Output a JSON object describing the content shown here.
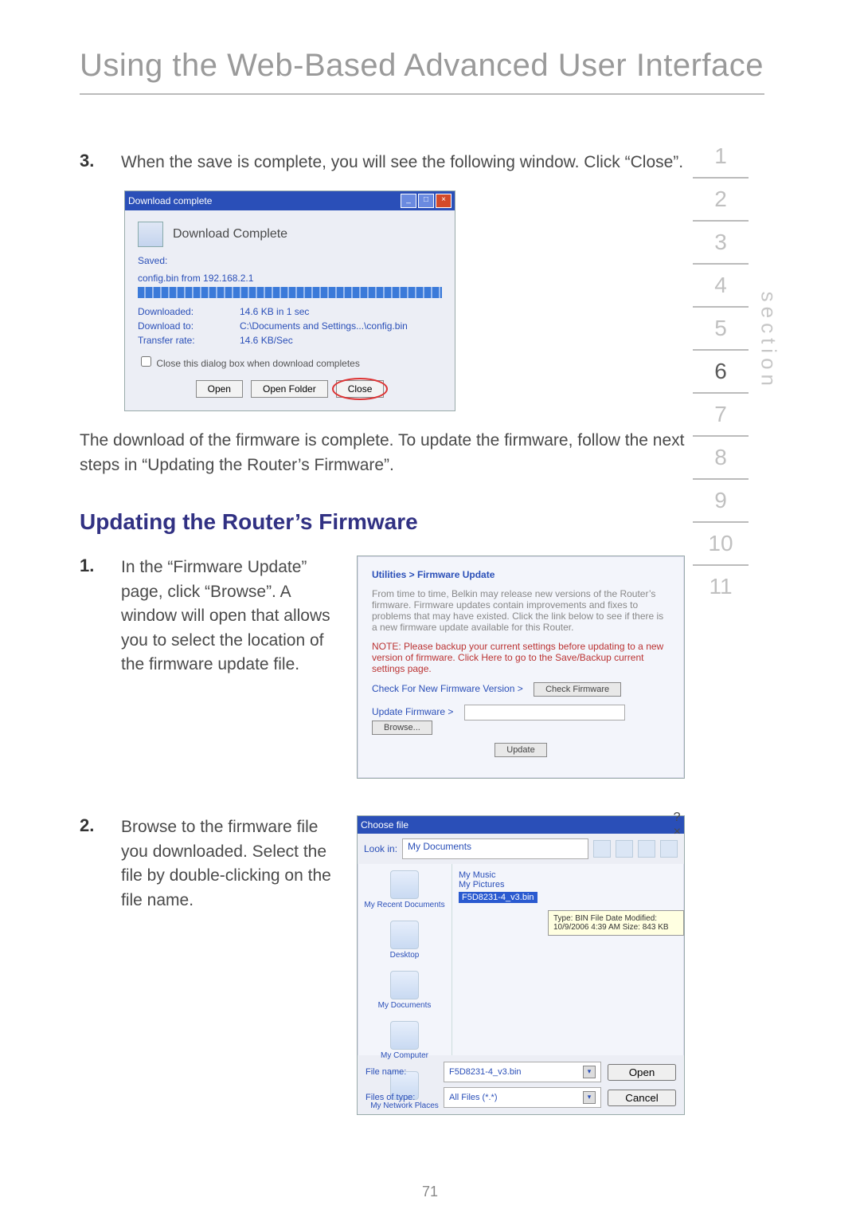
{
  "heading": "Using the Web-Based Advanced User Interface",
  "section_label": "section",
  "section_numbers": [
    "1",
    "2",
    "3",
    "4",
    "5",
    "6",
    "7",
    "8",
    "9",
    "10",
    "11"
  ],
  "active_section_index": 5,
  "page_number": "71",
  "step3": {
    "num": "3.",
    "body": "When the save is complete, you will see the following window. Click “Close”."
  },
  "para_after_ss1": "The download of the firmware is complete. To update the firmware, follow the next steps in “Updating the Router’s Firmware”.",
  "subheading": "Updating the Router’s Firmware",
  "step1": {
    "num": "1.",
    "body": "In the “Firmware Update” page, click “Browse”. A window will open that allows you to select the location of the firmware update file."
  },
  "step2": {
    "num": "2.",
    "body": "Browse to the firmware file you downloaded. Select the file by double-clicking on the file name."
  },
  "ss1": {
    "title": "Download complete",
    "header_text": "Download Complete",
    "saved": "Saved:",
    "file_line": "config.bin from 192.168.2.1",
    "rows": {
      "downloaded_lbl": "Downloaded:",
      "downloaded_val": "14.6 KB in 1 sec",
      "to_lbl": "Download to:",
      "to_val": "C:\\Documents and Settings...\\config.bin",
      "rate_lbl": "Transfer rate:",
      "rate_val": "14.6 KB/Sec"
    },
    "checkbox": "Close this dialog box when download completes",
    "btn_open": "Open",
    "btn_folder": "Open Folder",
    "btn_close": "Close"
  },
  "ss2": {
    "breadcrumb": "Utilities > Firmware Update",
    "para": "From time to time, Belkin may release new versions of the Router’s firmware. Firmware updates contain improvements and fixes to problems that may have existed. Click the link below to see if there is a new firmware update available for this Router.",
    "note": "NOTE: Please backup your current settings before updating to a new version of firmware. Click Here to go to the Save/Backup current settings page.",
    "check_label": "Check For New Firmware Version >",
    "check_btn": "Check Firmware",
    "update_label": "Update Firmware >",
    "browse_btn": "Browse...",
    "update_btn": "Update"
  },
  "ss3": {
    "title": "Choose file",
    "lookin_lbl": "Look in:",
    "lookin_val": "My Documents",
    "side_items": [
      "My Recent Documents",
      "Desktop",
      "My Documents",
      "My Computer",
      "My Network Places"
    ],
    "file_items": [
      "My Music",
      "My Pictures"
    ],
    "file_selected": "F5D8231-4_v3.bin",
    "tooltip": "Type: BIN File\nDate Modified: 10/9/2006 4:39 AM\nSize: 843 KB",
    "filename_lbl": "File name:",
    "filename_val": "F5D8231-4_v3.bin",
    "filetype_lbl": "Files of type:",
    "filetype_val": "All Files (*.*)",
    "open_btn": "Open",
    "cancel_btn": "Cancel"
  }
}
